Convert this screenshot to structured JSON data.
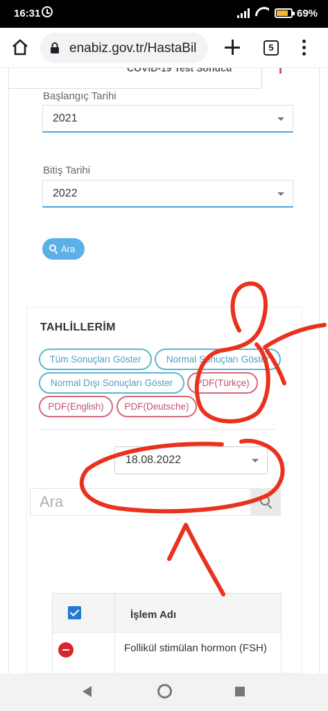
{
  "status_bar": {
    "time": "16:31",
    "battery": "69%"
  },
  "browser": {
    "url": "enabiz.gov.tr/HastaBil",
    "tab_count": "5"
  },
  "top_tab": {
    "label": "COVID-19 Test Sonucu"
  },
  "form": {
    "start_label": "Başlangıç Tarihi",
    "start_value": "2021",
    "end_label": "Bitiş Tarihi",
    "end_value": "2022",
    "search_button": "Ara"
  },
  "results": {
    "title": "TAHLİLLERİM",
    "filters": [
      "Tüm Sonuçları Göster",
      "Normal Sonuçları Göster",
      "Normal Dışı Sonuçları Göster",
      "PDF(Türkçe)",
      "PDF(English)",
      "PDF(Deutsche)"
    ],
    "date_value": "18.08.2022",
    "search_placeholder": "Ara",
    "table": {
      "column": "İşlem Adı",
      "rows": [
        {
          "name": "Follikül stimülan hormon (FSH)"
        }
      ]
    }
  },
  "colors": {
    "accent_blue": "#5bb0e8",
    "pill_blue": "#5bb6cf",
    "pill_red": "#d6667a",
    "annotation_red": "#e8321e"
  }
}
